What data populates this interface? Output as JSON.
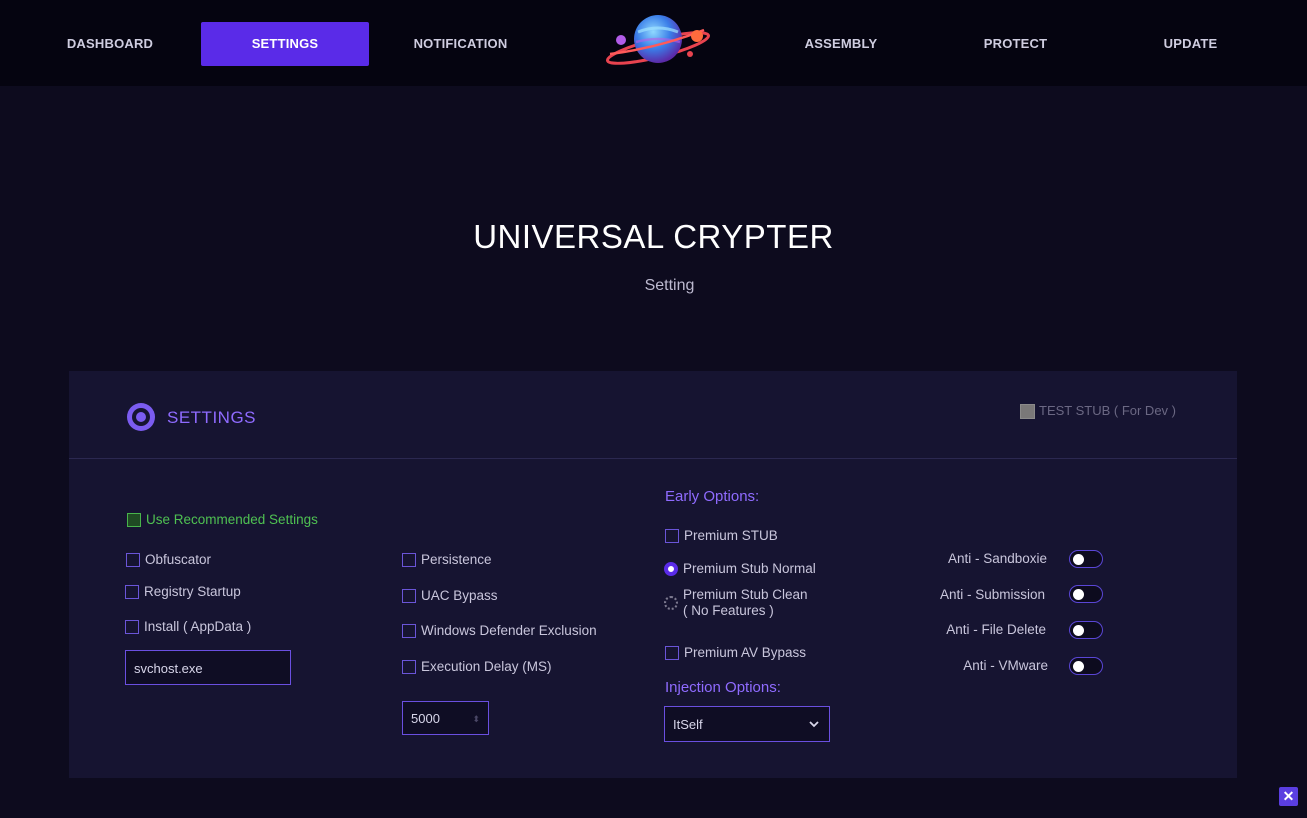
{
  "nav": {
    "dashboard": "DASHBOARD",
    "settings": "SETTINGS",
    "notification": "NOTIFICATION",
    "assembly": "ASSEMBLY",
    "protect": "PROTECT",
    "update": "UPDATE",
    "active": "SETTINGS"
  },
  "hero": {
    "title": "UNIVERSAL CRYPTER",
    "subtitle": "Setting"
  },
  "panel": {
    "title": "SETTINGS",
    "test_stub": {
      "label": "TEST STUB ( For Dev )",
      "checked": true
    }
  },
  "left": {
    "recommended": {
      "label": "Use Recommended Settings",
      "checked": false
    },
    "obfuscator": {
      "label": "Obfuscator",
      "checked": false
    },
    "registry_startup": {
      "label": "Registry Startup",
      "checked": false
    },
    "install_appdata": {
      "label": "Install ( AppData )",
      "checked": false
    },
    "install_name": "svchost.exe"
  },
  "middle": {
    "persistence": {
      "label": "Persistence",
      "checked": false
    },
    "uac_bypass": {
      "label": "UAC Bypass",
      "checked": false
    },
    "defender_exclusion": {
      "label": "Windows Defender Exclusion",
      "checked": false
    },
    "execution_delay": {
      "label": "Execution Delay (MS)",
      "checked": false
    },
    "delay_value": "5000"
  },
  "early": {
    "heading": "Early Options:",
    "premium_stub": {
      "label": "Premium STUB",
      "checked": false
    },
    "stub_normal": {
      "label": "Premium Stub Normal",
      "selected": true
    },
    "stub_clean": {
      "label_line1": "Premium Stub Clean",
      "label_line2": "( No Features )",
      "selected": false
    },
    "av_bypass": {
      "label": "Premium AV Bypass",
      "checked": false
    },
    "injection_heading": "Injection Options:",
    "injection_value": "ItSelf"
  },
  "anti": {
    "sandboxie": {
      "label": "Anti - Sandboxie",
      "on": false
    },
    "submission": {
      "label": "Anti - Submission",
      "on": false
    },
    "file_delete": {
      "label": "Anti - File Delete",
      "on": false
    },
    "vmware": {
      "label": "Anti - VMware",
      "on": false
    }
  },
  "colors": {
    "accent": "#5a2be8",
    "section": "#8f6bff",
    "background": "#0d0b1e",
    "panel": "#161431",
    "green": "#4fc152"
  },
  "icons": {
    "gear": "settings-gear-icon",
    "close": "close-icon",
    "logo": "planet-logo",
    "chevron": "chevron-down-icon"
  }
}
